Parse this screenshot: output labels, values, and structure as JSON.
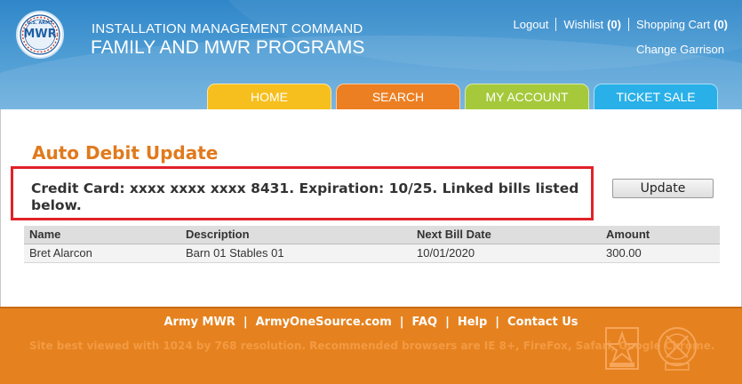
{
  "header": {
    "org_line1": "INSTALLATION MANAGEMENT COMMAND",
    "org_line2": "FAMILY AND MWR PROGRAMS",
    "logo": {
      "top_text": "U.S. ARMY",
      "main_text": "MWR"
    },
    "links": {
      "logout": "Logout",
      "wishlist": "Wishlist",
      "wishlist_count": "(0)",
      "cart": "Shopping Cart",
      "cart_count": "(0)",
      "change_garrison": "Change Garrison"
    },
    "tabs": [
      {
        "label": "HOME",
        "color": "#f7bf1d"
      },
      {
        "label": "SEARCH",
        "color": "#ec7f22"
      },
      {
        "label": "MY ACCOUNT",
        "color": "#a5c93b"
      },
      {
        "label": "TICKET SALE",
        "color": "#2ab0e8"
      }
    ]
  },
  "main": {
    "title": "Auto Debit Update",
    "card_info": "Credit Card: xxxx xxxx xxxx 8431. Expiration: 10/25. Linked bills listed below.",
    "update_button": "Update",
    "table": {
      "headers": [
        "Name",
        "Description",
        "Next Bill Date",
        "Amount"
      ],
      "rows": [
        [
          "Bret Alarcon",
          "Barn 01 Stables 01",
          "10/01/2020",
          "300.00"
        ]
      ]
    }
  },
  "footer": {
    "links": [
      "Army MWR",
      "ArmyOneSource.com",
      "FAQ",
      "Help",
      "Contact Us"
    ],
    "note": "Site best viewed with 1024 by 768 resolution. Recommended browsers are IE 8+, FireFox, Safari, Google Chrome."
  },
  "colors": {
    "header_blue": "#3a8fcd",
    "title_orange": "#e07a1d",
    "highlight_red": "#e12128",
    "footer_orange": "#e5821f"
  },
  "icons": [
    "mwr-logo-icon",
    "army-star-emblem-icon",
    "army-crest-emblem-icon"
  ]
}
